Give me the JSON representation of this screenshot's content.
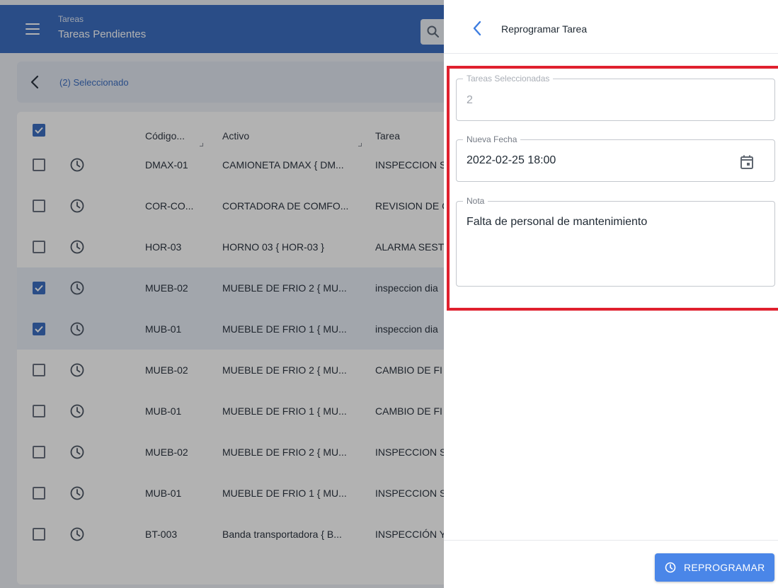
{
  "appbar": {
    "breadcrumb_parent": "Tareas",
    "title": "Tareas Pendientes"
  },
  "selection": {
    "label": "(2) Seleccionado"
  },
  "table": {
    "columns": [
      "Código...",
      "Activo",
      "Tarea"
    ],
    "rows": [
      {
        "checked": false,
        "code": "DMAX-01",
        "asset": "CAMIONETA DMAX { DM...",
        "task": "INSPECCION S"
      },
      {
        "checked": false,
        "code": "COR-CO...",
        "asset": "CORTADORA DE COMFO...",
        "task": "REVISION DE C"
      },
      {
        "checked": false,
        "code": "HOR-03",
        "asset": "HORNO 03 { HOR-03 }",
        "task": "ALARMA SEST"
      },
      {
        "checked": true,
        "code": "MUEB-02",
        "asset": "MUEBLE DE FRIO 2 { MU...",
        "task": "inspeccion dia"
      },
      {
        "checked": true,
        "code": "MUB-01",
        "asset": "MUEBLE DE FRIO 1 { MU...",
        "task": "inspeccion dia"
      },
      {
        "checked": false,
        "code": "MUEB-02",
        "asset": "MUEBLE DE FRIO 2 { MU...",
        "task": "CAMBIO DE FI"
      },
      {
        "checked": false,
        "code": "MUB-01",
        "asset": "MUEBLE DE FRIO 1 { MU...",
        "task": "CAMBIO DE FI"
      },
      {
        "checked": false,
        "code": "MUEB-02",
        "asset": "MUEBLE DE FRIO 2 { MU...",
        "task": "INSPECCION S"
      },
      {
        "checked": false,
        "code": "MUB-01",
        "asset": "MUEBLE DE FRIO 1 { MU...",
        "task": "INSPECCION S"
      },
      {
        "checked": false,
        "code": "BT-003",
        "asset": "Banda transportadora { B...",
        "task": "INSPECCIÓN Y"
      }
    ]
  },
  "panel": {
    "title": "Reprogramar Tarea",
    "fields": {
      "selected_tasks": {
        "label": "Tareas Seleccionadas",
        "value": "2"
      },
      "new_date": {
        "label": "Nueva Fecha",
        "value": "2022-02-25 18:00"
      },
      "note": {
        "label": "Nota",
        "value": "Falta de personal de mantenimiento"
      }
    },
    "submit_label": "REPROGRAMAR"
  },
  "colors": {
    "primary": "#3d6fc2",
    "button": "#4a86e8",
    "highlight": "#e0202e"
  },
  "icons": [
    "menu-icon",
    "search-icon",
    "back-arrow-icon",
    "clock-icon",
    "calendar-icon",
    "checkbox-icon"
  ]
}
